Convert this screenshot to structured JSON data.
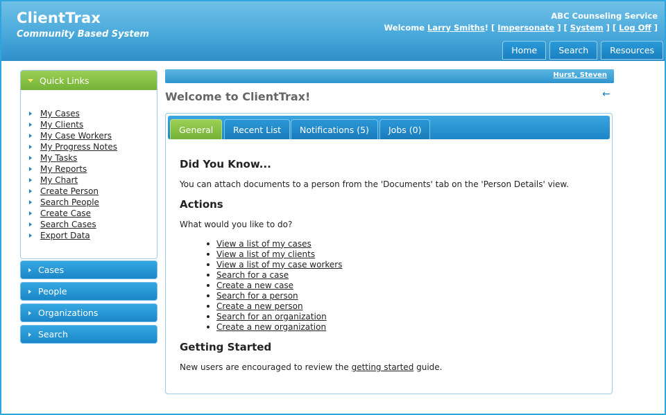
{
  "header": {
    "app_title": "ClientTrax",
    "app_subtitle": "Community Based System",
    "org_name": "ABC Counseling Service",
    "welcome_prefix": "Welcome ",
    "user_name": "Larry Smiths",
    "sep1": "! [ ",
    "impersonate": "Impersonate",
    "sep2": " ] [ ",
    "system": "System",
    "sep3": " ] [ ",
    "logoff": "Log Off",
    "sep4": " ]",
    "nav": [
      "Home",
      "Search",
      "Resources"
    ]
  },
  "sidebar": {
    "quick_links_title": "Quick Links",
    "quick_links": [
      "My Cases",
      "My Clients",
      "My Case Workers",
      "My Progress Notes",
      "My Tasks",
      "My Reports",
      "My Chart",
      "Create Person",
      "Search People",
      "Create Case",
      "Search Cases",
      "Export Data"
    ],
    "categories": [
      "Cases",
      "People",
      "Organizations",
      "Search"
    ]
  },
  "main": {
    "breadcrumb_user": "Hurst, Steven",
    "page_title": "Welcome to ClientTrax!",
    "tabs": [
      "General",
      "Recent List",
      "Notifications (5)",
      "Jobs (0)"
    ],
    "did_you_know_heading": "Did You Know...",
    "did_you_know_text": "You can attach documents to a person from the 'Documents' tab on the 'Person Details' view.",
    "actions_heading": "Actions",
    "actions_prompt": "What would you like to do?",
    "action_links": [
      "View a list of my cases",
      "View a list of my clients",
      "View a list of my case workers",
      "Search for a case",
      "Create a new case",
      "Search for a person",
      "Create a new person",
      "Search for an organization",
      "Create a new organization"
    ],
    "getting_started_heading": "Getting Started",
    "getting_started_prefix": "New users are encouraged to review the ",
    "getting_started_link": "getting started",
    "getting_started_suffix": " guide."
  },
  "colors": {
    "accent_blue": "#1a7fc0",
    "accent_green": "#74b237",
    "border": "#9ccbe4"
  },
  "icons": {
    "back": "back-arrow-icon"
  }
}
